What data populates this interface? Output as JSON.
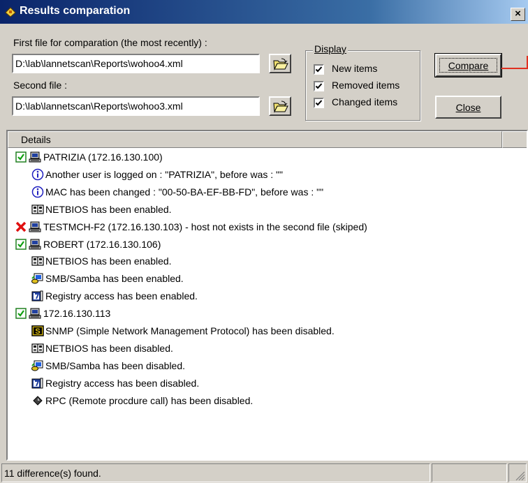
{
  "window": {
    "title": "Results comparation",
    "close_label": "×"
  },
  "first_file": {
    "label": "First file for comparation (the most recently) :",
    "value": "D:\\lab\\lannetscan\\Reports\\wohoo4.xml"
  },
  "second_file": {
    "label": "Second file :",
    "value": "D:\\lab\\lannetscan\\Reports\\wohoo3.xml"
  },
  "display": {
    "title": "Display",
    "options": [
      {
        "label": "New items",
        "checked": true
      },
      {
        "label": "Removed items",
        "checked": true
      },
      {
        "label": "Changed items",
        "checked": true
      }
    ]
  },
  "buttons": {
    "compare": "Compare",
    "close": "Close"
  },
  "list": {
    "header": "Details",
    "rows": [
      {
        "icon": "green-check-icon",
        "icon2": "computer-icon",
        "text": "PATRIZIA (172.16.130.100)",
        "level": 0
      },
      {
        "icon": "info-icon",
        "text": "Another user is logged on : \"PATRIZIA\", before was : \"\"",
        "level": 1
      },
      {
        "icon": "info-icon",
        "text": "MAC has been changed : \"00-50-BA-EF-BB-FD\", before was : \"\"",
        "level": 1
      },
      {
        "icon": "netbios-icon",
        "text": "NETBIOS has been enabled.",
        "level": 1
      },
      {
        "icon": "red-x-icon",
        "icon2": "computer-icon",
        "text": "TESTMCH-F2 (172.16.130.103) - host not exists in the second file (skiped)",
        "level": 0
      },
      {
        "icon": "green-check-icon",
        "icon2": "computer-icon",
        "text": "ROBERT (172.16.130.106)",
        "level": 0
      },
      {
        "icon": "netbios-icon",
        "text": "NETBIOS has been enabled.",
        "level": 1
      },
      {
        "icon": "samba-icon",
        "text": "SMB/Samba has been enabled.",
        "level": 1
      },
      {
        "icon": "registry-icon",
        "text": "Registry access has been enabled.",
        "level": 1
      },
      {
        "icon": "green-check-icon",
        "icon2": "computer-icon",
        "text": "172.16.130.113",
        "level": 0
      },
      {
        "icon": "snmp-icon",
        "text": "SNMP (Simple Network Management Protocol) has been disabled.",
        "level": 1
      },
      {
        "icon": "netbios-icon",
        "text": "NETBIOS has been disabled.",
        "level": 1
      },
      {
        "icon": "samba-icon",
        "text": "SMB/Samba has been disabled.",
        "level": 1
      },
      {
        "icon": "registry-icon",
        "text": "Registry access has been disabled.",
        "level": 1
      },
      {
        "icon": "rpc-icon",
        "text": "RPC (Remote procdure call) has been disabled.",
        "level": 1
      }
    ]
  },
  "status": {
    "text": "11 difference(s) found."
  },
  "colors": {
    "title_bar": "#0a246a",
    "face": "#d4d0c8",
    "accent_line": "#e03020"
  }
}
